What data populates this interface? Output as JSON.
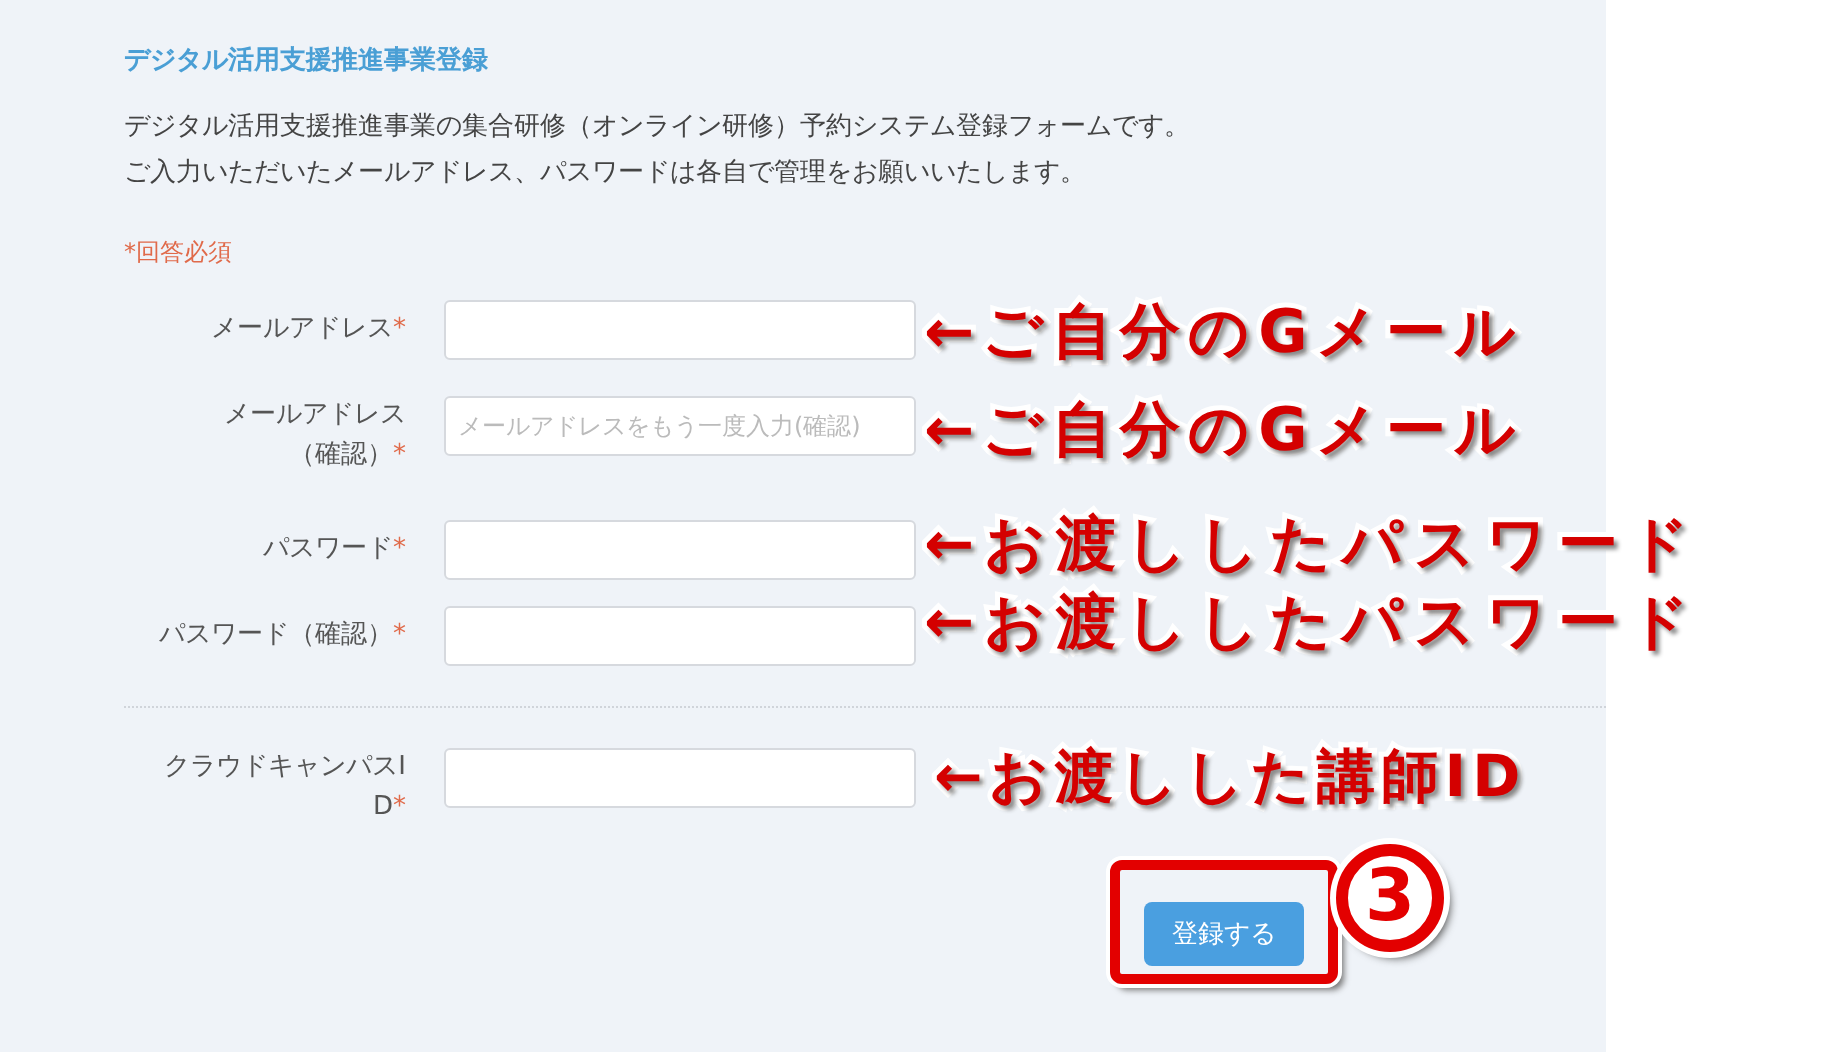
{
  "form": {
    "title": "デジタル活用支援推進事業登録",
    "description": [
      "デジタル活用支援推進事業の集合研修（オンライン研修）予約システム登録フォームです。",
      "ご入力いただいたメールアドレス、パスワードは各自で管理をお願いいたします。"
    ],
    "required_note": "*回答必須",
    "fields": [
      {
        "label_lines": [
          "メールアドレス"
        ],
        "mark": "*"
      },
      {
        "label_lines": [
          "メールアドレス",
          "（確認）"
        ],
        "mark": "*",
        "placeholder": "メールアドレスをもう一度入力(確認)"
      },
      {
        "label_lines": [
          "パスワード"
        ],
        "mark": "*"
      },
      {
        "label_lines": [
          "パスワード（確認）"
        ],
        "mark": "*",
        "divider_after": true
      },
      {
        "label_lines": [
          "クラウドキャンパスI",
          "D"
        ],
        "mark": "*"
      }
    ],
    "submit": "登録する"
  },
  "annotations": [
    {
      "kind": "text",
      "text": "←ご自分のGメール"
    },
    {
      "kind": "text",
      "text": "←ご自分のGメール"
    },
    {
      "kind": "text",
      "text": "←お渡ししたパスワード"
    },
    {
      "kind": "text",
      "text": "←お渡ししたパスワード"
    },
    {
      "kind": "text",
      "text": "←お渡しした講師ID"
    },
    {
      "kind": "badge",
      "text": "3"
    }
  ]
}
